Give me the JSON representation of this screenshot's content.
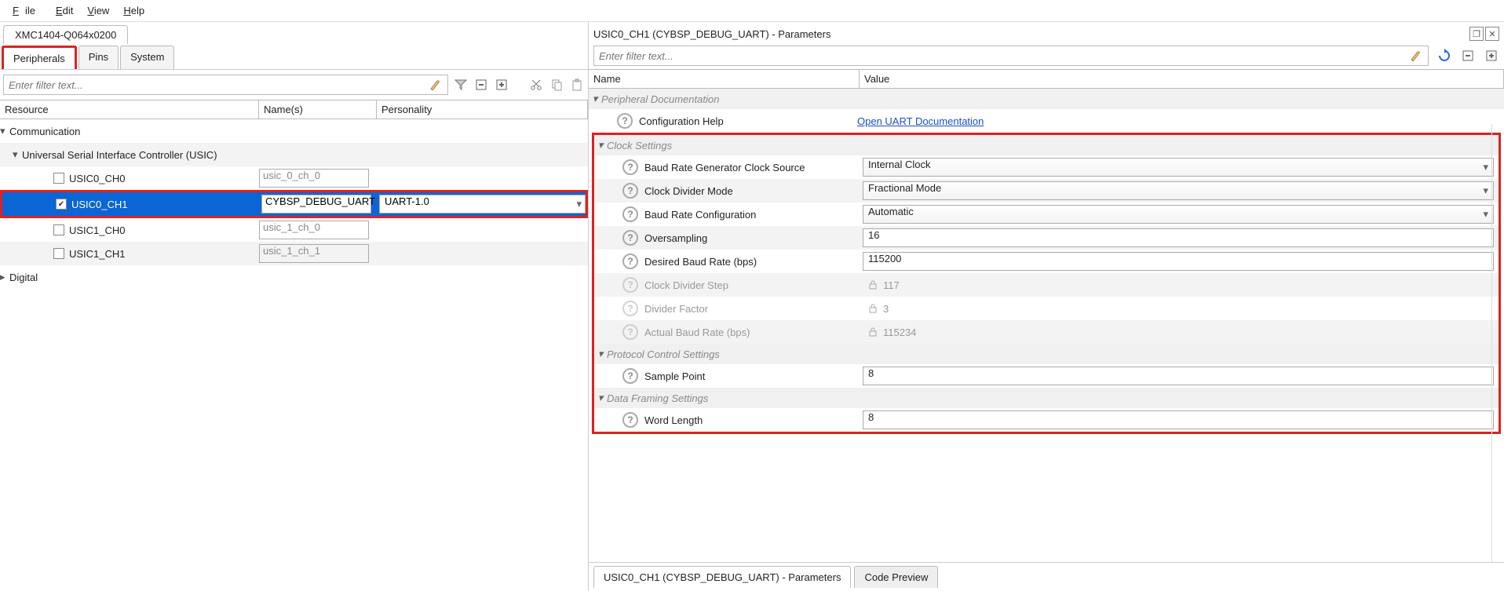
{
  "menu": {
    "file": "File",
    "edit": "Edit",
    "view": "View",
    "help": "Help"
  },
  "deviceTab": "XMC1404-Q064x0200",
  "subtabs": {
    "peripherals": "Peripherals",
    "pins": "Pins",
    "system": "System"
  },
  "leftFilterPlaceholder": "Enter filter text...",
  "treeCols": {
    "resource": "Resource",
    "names": "Name(s)",
    "personality": "Personality"
  },
  "tree": {
    "communication": "Communication",
    "usic": "Universal Serial Interface Controller (USIC)",
    "ch": [
      {
        "label": "USIC0_CH0",
        "name_ph": "usic_0_ch_0",
        "checked": false
      },
      {
        "label": "USIC0_CH1",
        "name_val": "CYBSP_DEBUG_UART",
        "pers": "UART-1.0",
        "checked": true
      },
      {
        "label": "USIC1_CH0",
        "name_ph": "usic_1_ch_0",
        "checked": false
      },
      {
        "label": "USIC1_CH1",
        "name_ph": "usic_1_ch_1",
        "checked": false
      }
    ],
    "digital": "Digital"
  },
  "rp": {
    "title": "USIC0_CH1 (CYBSP_DEBUG_UART) - Parameters",
    "filterPlaceholder": "Enter filter text...",
    "cols": {
      "name": "Name",
      "value": "Value"
    },
    "groups": {
      "doc": "Peripheral Documentation",
      "clock": "Clock Settings",
      "proto": "Protocol Control Settings",
      "frame": "Data Framing Settings"
    },
    "params": {
      "confHelp": {
        "n": "Configuration Help",
        "v": "Open UART Documentation"
      },
      "brgSrc": {
        "n": "Baud Rate Generator Clock Source",
        "v": "Internal Clock"
      },
      "divMode": {
        "n": "Clock Divider Mode",
        "v": "Fractional Mode"
      },
      "brConf": {
        "n": "Baud Rate Configuration",
        "v": "Automatic"
      },
      "oversamp": {
        "n": "Oversampling",
        "v": "16"
      },
      "desBaud": {
        "n": "Desired Baud Rate (bps)",
        "v": "115200"
      },
      "divStep": {
        "n": "Clock Divider Step",
        "v": "117"
      },
      "divFact": {
        "n": "Divider Factor",
        "v": "3"
      },
      "actBaud": {
        "n": "Actual Baud Rate (bps)",
        "v": "115234"
      },
      "sampPt": {
        "n": "Sample Point",
        "v": "8"
      },
      "wordLen": {
        "n": "Word Length",
        "v": "8"
      }
    },
    "bottomTabs": {
      "params": "USIC0_CH1 (CYBSP_DEBUG_UART) - Parameters",
      "code": "Code Preview"
    }
  }
}
